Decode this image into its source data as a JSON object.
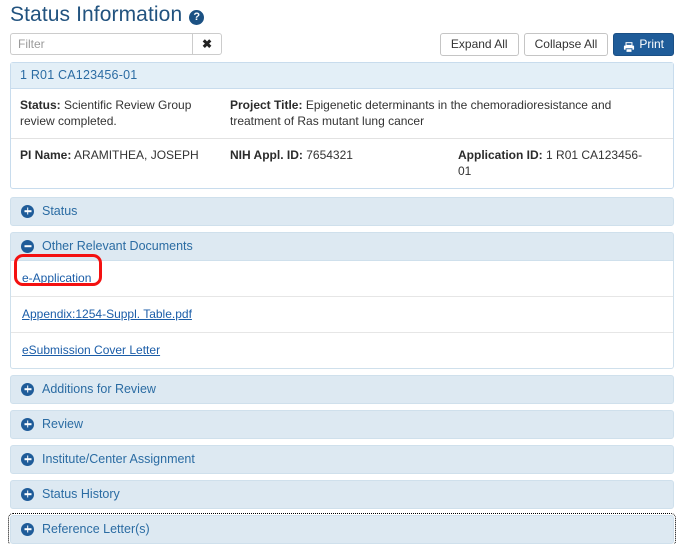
{
  "header": {
    "title": "Status Information",
    "help_icon": "help-circle-icon",
    "help_glyph": "?"
  },
  "toolbar": {
    "filter_value": "",
    "filter_placeholder": "Filter",
    "clear_label": "✖",
    "expand_all_label": "Expand All",
    "collapse_all_label": "Collapse All",
    "print_label": "Print",
    "print_icon": "printer-icon"
  },
  "summary": {
    "panel_title": "1 R01 CA123456-01",
    "status_label": "Status:",
    "status_value": "Scientific Review Group review completed.",
    "project_title_label": "Project Title:",
    "project_title_value": "Epigenetic determinants in the chemoradioresistance and treatment of Ras mutant lung cancer",
    "pi_name_label": "PI Name:",
    "pi_name_value": "ARAMITHEA, JOSEPH",
    "nih_appl_id_label": "NIH Appl. ID:",
    "nih_appl_id_value": "7654321",
    "application_id_label": "Application ID:",
    "application_id_value": "1 R01 CA123456-01"
  },
  "accordion": [
    {
      "label": "Status",
      "state": "collapsed",
      "icon": "plus-circle-icon"
    },
    {
      "label": "Other Relevant Documents",
      "state": "expanded",
      "icon": "minus-circle-icon"
    },
    {
      "label": "Additions for Review",
      "state": "collapsed",
      "icon": "plus-circle-icon"
    },
    {
      "label": "Review",
      "state": "collapsed",
      "icon": "plus-circle-icon"
    },
    {
      "label": "Institute/Center Assignment",
      "state": "collapsed",
      "icon": "plus-circle-icon"
    },
    {
      "label": "Status History",
      "state": "collapsed",
      "icon": "plus-circle-icon"
    },
    {
      "label": "Reference Letter(s)",
      "state": "collapsed",
      "icon": "plus-circle-icon"
    }
  ],
  "documents": [
    {
      "label": "e-Application",
      "highlighted": true
    },
    {
      "label": "Appendix:1254-Suppl. Table.pdf",
      "highlighted": false
    },
    {
      "label": "eSubmission Cover Letter",
      "highlighted": false
    }
  ],
  "colors": {
    "heading_blue": "#22537f",
    "link_blue": "#1b5da8",
    "accordion_bg": "#dde9f2",
    "panel_head_bg": "#e3eff7",
    "primary_button": "#1f5c99",
    "annotation_red": "#f41111"
  }
}
